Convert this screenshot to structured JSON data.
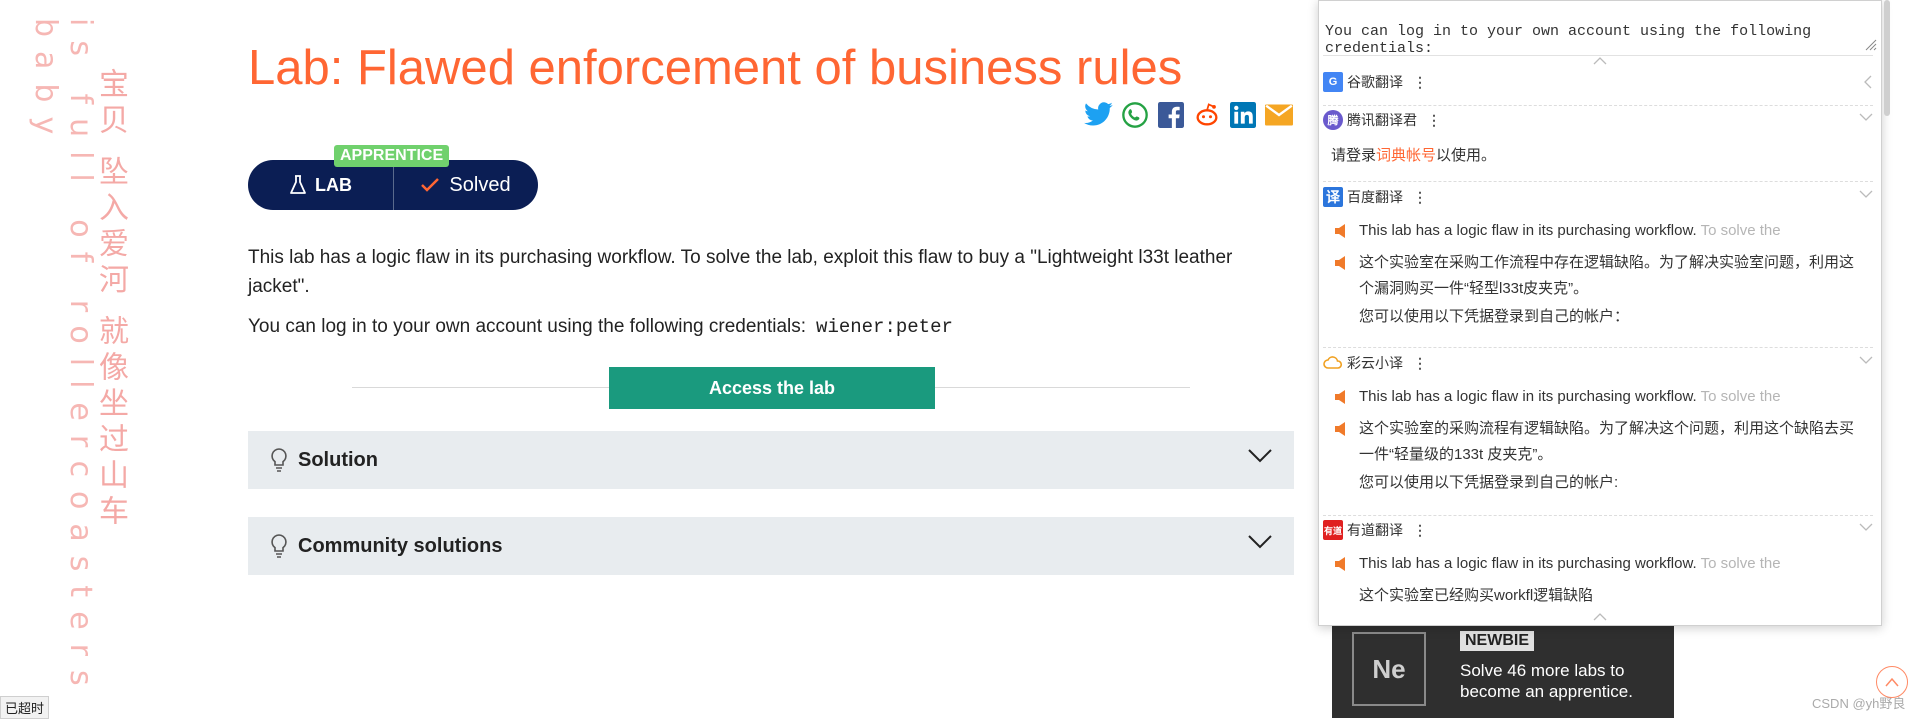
{
  "decor": {
    "vertical_en": "is full of rollercoasters   baby",
    "vertical_cn": "宝贝 坠入爱河 就像坐过山车"
  },
  "page": {
    "title": "Lab: Flawed enforcement of business rules",
    "share_icons": [
      "twitter-icon",
      "whatsapp-icon",
      "facebook-icon",
      "reddit-icon",
      "linkedin-icon",
      "email-icon"
    ],
    "level_badge": "APPRENTICE",
    "lab_label": "LAB",
    "solved_label": "Solved",
    "description": "This lab has a logic flaw in its purchasing workflow. To solve the lab, exploit this flaw to buy a \"Lightweight l33t leather jacket\".",
    "creds_text": "You can log in to your own account using the following credentials:",
    "creds_value": "wiener:peter",
    "access_button": "Access the lab",
    "accordions": [
      "Solution",
      "Community solutions"
    ],
    "colors": {
      "title": "#ff6633",
      "badge_bg": "#0b1e54",
      "access_bg": "#1a9a7e",
      "apprentice": "#70d16d"
    }
  },
  "newbie": {
    "logo_text": "Ne",
    "badge": "NEWBIE",
    "text": "Solve 46 more labs to become an apprentice."
  },
  "popup": {
    "source_text": "You can log in to your own account using the following credentials:",
    "google": {
      "name": "谷歌翻译",
      "logo": "G"
    },
    "tencent": {
      "name": "腾讯翻译君",
      "logo": "腾",
      "login_pre": "请登录",
      "login_link": "词典帐号",
      "login_post": "以使用。"
    },
    "baidu": {
      "name": "百度翻译",
      "logo": "译",
      "src_en": "This lab has a logic flaw in its purchasing workflow.",
      "src_fade": "To solve the",
      "trans": "这个实验室在采购工作流程中存在逻辑缺陷。为了解决实验室问题，利用这个漏洞购买一件“轻型l33t皮夹克”。",
      "creds": "您可以使用以下凭据登录到自己的帐户："
    },
    "caiyun": {
      "name": "彩云小译",
      "logo": "云",
      "src_en": "This lab has a logic flaw in its purchasing workflow.",
      "src_fade": "To solve the",
      "trans": "这个实验室的采购流程有逻辑缺陷。为了解决这个问题，利用这个缺陷去买一件“轻量级的133t 皮夹克”。",
      "creds": "您可以使用以下凭据登录到自己的帐户:"
    },
    "youdao": {
      "name": "有道翻译",
      "logo": "有道",
      "src_en": "This lab has a logic flaw in its purchasing workflow.",
      "src_fade": "To solve the",
      "trans": "这个实验室已经购买workfl逻辑缺陷"
    }
  },
  "status": {
    "left": "已超时",
    "watermark": "CSDN @yh野良"
  }
}
